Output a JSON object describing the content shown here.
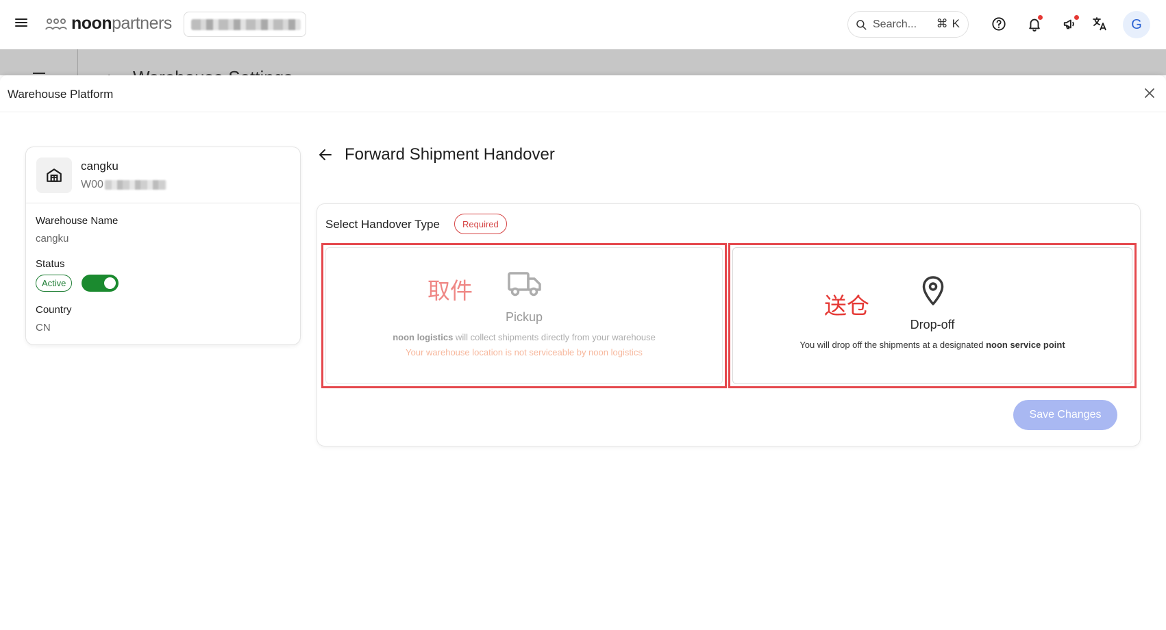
{
  "header": {
    "logo": {
      "bold": "noon",
      "light": "partners"
    },
    "search": {
      "placeholder": "Search...",
      "shortcut_symbol": "⌘",
      "shortcut_key": "K"
    },
    "avatar_letter": "G",
    "icons": [
      "menu-icon",
      "help-icon",
      "bell-icon",
      "megaphone-icon",
      "translate-icon"
    ]
  },
  "background_page": {
    "title": "Warehouse Settings"
  },
  "dialog": {
    "title": "Warehouse Platform"
  },
  "warehouse": {
    "name": "cangku",
    "code_prefix": "W00",
    "fields": {
      "name_label": "Warehouse Name",
      "name_value": "cangku",
      "status_label": "Status",
      "status_value": "Active",
      "country_label": "Country",
      "country_value": "CN"
    }
  },
  "handover": {
    "title": "Forward Shipment Handover",
    "type_label": "Select Handover Type",
    "required_label": "Required",
    "options": {
      "pickup": {
        "annotation": "取件",
        "title": "Pickup",
        "desc_bold": "noon logistics",
        "desc_rest": " will collect shipments directly from your warehouse",
        "warning": "Your warehouse location is not serviceable by noon logistics"
      },
      "dropoff": {
        "annotation": "送仓",
        "title": "Drop-off",
        "desc_rest": "You will drop off the shipments at a designated ",
        "desc_bold": "noon service point"
      }
    },
    "save_label": "Save Changes"
  },
  "colors": {
    "accent_green": "#1b8a2f",
    "required_red": "#d64545",
    "annotation_red": "#e5484d",
    "warning_orange": "#f2885b",
    "save_disabled": "#a9b8f2"
  }
}
